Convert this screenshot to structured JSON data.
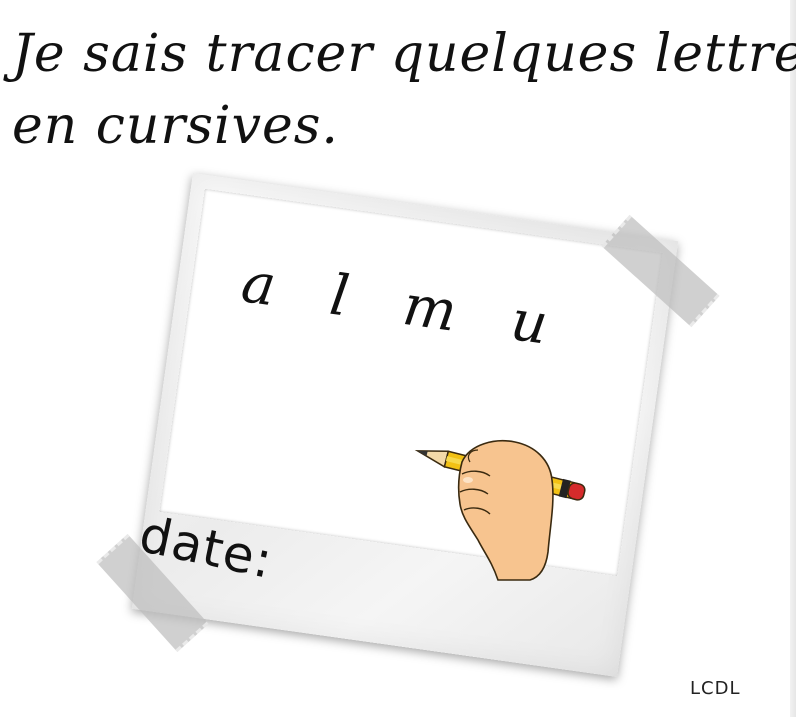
{
  "title": {
    "line1": "Je sais tracer quelques lettres",
    "line2": "en cursives."
  },
  "card": {
    "letters": [
      "a",
      "l",
      "m",
      "u"
    ],
    "date_label": "date:"
  },
  "footer": {
    "credit": "LCDL"
  },
  "colors": {
    "pencil_body": "#f2c114",
    "pencil_eraser": "#d62b2b",
    "skin": "#f7c48f",
    "tape": "#bebebe"
  },
  "icons": {
    "hand": "hand-writing-with-pencil-icon"
  }
}
